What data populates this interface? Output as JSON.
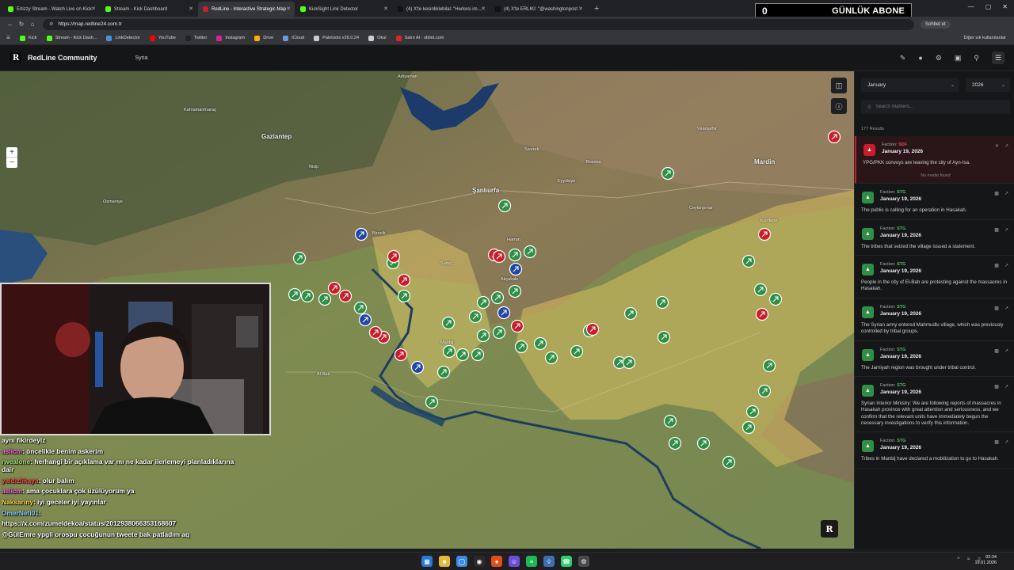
{
  "browser": {
    "tabs": [
      {
        "title": "Erlizzy Stream - Watch Live on Kick",
        "color": "#53fc18",
        "active": false
      },
      {
        "title": "Stream - Kick Dashboard",
        "color": "#53fc18",
        "active": false
      },
      {
        "title": "RedLine - Interactive Strategic Map",
        "color": "#c81e2a",
        "active": true
      },
      {
        "title": "KickSight Link Detector",
        "color": "#53fc18",
        "active": false
      },
      {
        "title": "(4) X'te kesinliklebilal: \"Herkesi im...",
        "color": "#111111",
        "active": false
      },
      {
        "title": "(4) X'te ERLIKI: \"@washingtonpost",
        "color": "#111111",
        "active": false
      }
    ],
    "new_tab": "+",
    "url": "https://map.redline24.com.tr",
    "chat_chip": "Sohbet et",
    "bookmarks": [
      "Kick",
      "Stream - Kick Dash...",
      "LinkDetector",
      "YouTube",
      "Twitter",
      "Instagram",
      "Drive",
      "iCloud",
      "Paletools v26.0.24",
      "Okul",
      "Satın Al - obilet.com"
    ],
    "bookmark_colors": [
      "#53fc18",
      "#53fc18",
      "#4a90e2",
      "#ff0000",
      "#222222",
      "#d6249f",
      "#f4b400",
      "#6a9bd8",
      "#cccccc",
      "#cccccc",
      "#e02424"
    ],
    "bookmarks_right": "Diğer sık kullanılanlar"
  },
  "subscriber_box": {
    "count": "0",
    "label": "GÜNLÜK ABONE"
  },
  "app": {
    "logo": "R",
    "name": "RedLine Community",
    "region": "Syria"
  },
  "sidebar": {
    "month": "January",
    "year": "2026",
    "search_placeholder": "Search Markers...",
    "results_count": "177 Results",
    "cards": [
      {
        "faction": "SDF",
        "date": "January 19, 2026",
        "text": "YPG/PKK convoys are leaving the city of Ayn-Isa.",
        "extra": "No media found",
        "color": "#c81e2a",
        "highlighted": true
      },
      {
        "faction": "STG",
        "date": "January 19, 2026",
        "text": "The public is calling for an operation in Hasakah.",
        "color": "#2f8f45"
      },
      {
        "faction": "STG",
        "date": "January 19, 2026",
        "text": "The tribes that seized the village issued a statement.",
        "color": "#2f8f45"
      },
      {
        "faction": "STG",
        "date": "January 19, 2026",
        "text": "People in the city of El-Bab are protesting against the massacres in Hasakah.",
        "color": "#2f8f45"
      },
      {
        "faction": "STG",
        "date": "January 19, 2026",
        "text": "The Syrian army entered Mahmudlu village, which was previously controlled by tribal groups.",
        "color": "#2f8f45"
      },
      {
        "faction": "STG",
        "date": "January 19, 2026",
        "text": "The Jarniyah region was brought under tribal control.",
        "color": "#2f8f45"
      },
      {
        "faction": "STG",
        "date": "January 19, 2026",
        "text": "Syrian Interior Ministry: We are following reports of massacres in Hasakah province with great attention and seriousness, and we confirm that the relevant units have immediately begun the necessary investigations to verify this information.",
        "color": "#2f8f45"
      },
      {
        "faction": "STG",
        "date": "January 19, 2026",
        "text": "Tribes in Manbij have declared a mobilization to go to Hasakah.",
        "color": "#2f8f45"
      }
    ]
  },
  "map": {
    "places": [
      {
        "name": "Adıyaman",
        "kind": "town"
      },
      {
        "name": "Kahramanmaraş",
        "kind": "town"
      },
      {
        "name": "Gaziantep",
        "kind": "city"
      },
      {
        "name": "Şanlıurfa",
        "kind": "city"
      },
      {
        "name": "Osmaniye",
        "kind": "town"
      },
      {
        "name": "Mardin",
        "kind": "city"
      },
      {
        "name": "Siverek",
        "kind": "town"
      },
      {
        "name": "Viranşehir",
        "kind": "town"
      },
      {
        "name": "Harran",
        "kind": "town"
      },
      {
        "name": "Ceylanpınar",
        "kind": "town"
      },
      {
        "name": "Kızıltepe",
        "kind": "town"
      },
      {
        "name": "Eyyübiye",
        "kind": "town"
      },
      {
        "name": "Bozova",
        "kind": "town"
      },
      {
        "name": "Birecik",
        "kind": "town"
      },
      {
        "name": "Nizip",
        "kind": "town"
      },
      {
        "name": "Kilis",
        "kind": "town"
      },
      {
        "name": "Akçakale",
        "kind": "town"
      },
      {
        "name": "Suruç",
        "kind": "town"
      },
      {
        "name": "Manbij",
        "kind": "town"
      },
      {
        "name": "Al-Bab",
        "kind": "town"
      }
    ]
  },
  "chat": [
    {
      "user": "",
      "user_color": "#ffffff",
      "msg": "aynı fikirdeyiz"
    },
    {
      "user": "aslicm",
      "user_color": "#ff6be6",
      "msg": ": öncelikle benim askerim"
    },
    {
      "user": "rwealone",
      "user_color": "#9be37a",
      "msg": ": herhangi bir açıklama var mı ne kadar ilerlemeyi planladıklarına dair"
    },
    {
      "user": "yaldızlikaya",
      "user_color": "#ff4d4d",
      "msg": ": olur balım"
    },
    {
      "user": "aslicm",
      "user_color": "#ff6be6",
      "msg": ": ama çocuklara çok üzülüyorum ya"
    },
    {
      "user": "Naksariny",
      "user_color": "#ffd84a",
      "msg": ": iyi geceler iyi yayınlar"
    },
    {
      "user": "OmerNefi01",
      "user_color": "#8ed0ff",
      "msg": ":"
    },
    {
      "user": "",
      "user_color": "#ffffff",
      "msg": "https://x.com/zumeldekoa/status/2012938066353168607"
    },
    {
      "user": "@GülEmre",
      "user_color": "#ffffff",
      "msg": " ypgli orospu çocuğunun tweete bak patladım aq"
    }
  ],
  "taskbar": {
    "time": "02:34",
    "date": "19.01.2026"
  }
}
